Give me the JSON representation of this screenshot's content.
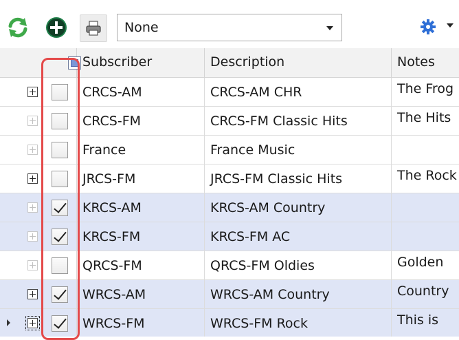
{
  "toolbar": {
    "refresh_icon": "refresh-icon",
    "add_icon": "add-circle-icon",
    "print_icon": "print-icon",
    "filter_value": "None",
    "settings_icon": "gear-icon",
    "colors": {
      "refresh": "#3fa94a",
      "add": "#1f7f4a",
      "settings": "#2f6fd6"
    }
  },
  "grid": {
    "columns": [
      "",
      "",
      "Subscriber",
      "Description",
      "Notes"
    ],
    "rows": [
      {
        "subscriber": "CRCS-AM",
        "description": "CRCS-AM CHR",
        "notes": "The Frog",
        "checked": false,
        "expander": "active",
        "selected": false
      },
      {
        "subscriber": "CRCS-FM",
        "description": "CRCS-FM Classic Hits",
        "notes": "The Hits",
        "checked": false,
        "expander": "dim",
        "selected": false
      },
      {
        "subscriber": "France",
        "description": "France Music",
        "notes": "",
        "checked": false,
        "expander": "dim",
        "selected": false
      },
      {
        "subscriber": "JRCS-FM",
        "description": "JRCS-FM Classic Hits",
        "notes": "The Rock",
        "checked": false,
        "expander": "active",
        "selected": false
      },
      {
        "subscriber": "KRCS-AM",
        "description": "KRCS-AM Country",
        "notes": "",
        "checked": true,
        "expander": "dim",
        "selected": true
      },
      {
        "subscriber": "KRCS-FM",
        "description": "KRCS-FM AC",
        "notes": "",
        "checked": true,
        "expander": "dim",
        "selected": true
      },
      {
        "subscriber": "QRCS-FM",
        "description": "QRCS-FM Oldies",
        "notes": "Golden",
        "checked": false,
        "expander": "dim",
        "selected": false
      },
      {
        "subscriber": "WRCS-AM",
        "description": "WRCS-AM Country",
        "notes": "Country",
        "checked": true,
        "expander": "active",
        "selected": true
      },
      {
        "subscriber": "WRCS-FM",
        "description": "WRCS-FM Rock",
        "notes": "This is",
        "checked": true,
        "expander": "active",
        "selected": true,
        "current": true
      }
    ],
    "highlight_color": "#e44a4a",
    "selected_row_color": "#dfe5f6"
  }
}
